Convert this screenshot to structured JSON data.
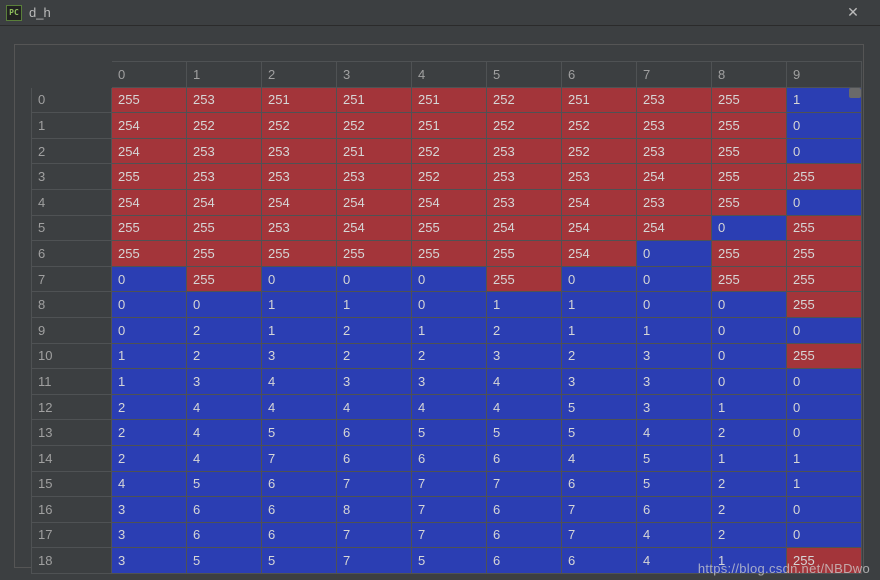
{
  "window": {
    "title": "d_h",
    "icon_text": "PC",
    "close_glyph": "✕"
  },
  "threshold": 128,
  "columns": [
    "0",
    "1",
    "2",
    "3",
    "4",
    "5",
    "6",
    "7",
    "8",
    "9"
  ],
  "rows": [
    "0",
    "1",
    "2",
    "3",
    "4",
    "5",
    "6",
    "7",
    "8",
    "9",
    "10",
    "11",
    "12",
    "13",
    "14",
    "15",
    "16",
    "17",
    "18"
  ],
  "cells": [
    [
      255,
      253,
      251,
      251,
      251,
      252,
      251,
      253,
      255,
      1
    ],
    [
      254,
      252,
      252,
      252,
      251,
      252,
      252,
      253,
      255,
      0
    ],
    [
      254,
      253,
      253,
      251,
      252,
      253,
      252,
      253,
      255,
      0
    ],
    [
      255,
      253,
      253,
      253,
      252,
      253,
      253,
      254,
      255,
      255
    ],
    [
      254,
      254,
      254,
      254,
      254,
      253,
      254,
      253,
      255,
      0
    ],
    [
      255,
      255,
      253,
      254,
      255,
      254,
      254,
      254,
      0,
      255
    ],
    [
      255,
      255,
      255,
      255,
      255,
      255,
      254,
      0,
      255,
      255
    ],
    [
      0,
      255,
      0,
      0,
      0,
      255,
      0,
      0,
      255,
      255
    ],
    [
      0,
      0,
      1,
      1,
      0,
      1,
      1,
      0,
      0,
      255
    ],
    [
      0,
      2,
      1,
      2,
      1,
      2,
      1,
      1,
      0,
      0
    ],
    [
      1,
      2,
      3,
      2,
      2,
      3,
      2,
      3,
      0,
      255
    ],
    [
      1,
      3,
      4,
      3,
      3,
      4,
      3,
      3,
      0,
      0
    ],
    [
      2,
      4,
      4,
      4,
      4,
      4,
      5,
      3,
      1,
      0
    ],
    [
      2,
      4,
      5,
      6,
      5,
      5,
      5,
      4,
      2,
      0
    ],
    [
      2,
      4,
      7,
      6,
      6,
      6,
      4,
      5,
      1,
      1
    ],
    [
      4,
      5,
      6,
      7,
      7,
      7,
      6,
      5,
      2,
      1
    ],
    [
      3,
      6,
      6,
      8,
      7,
      6,
      7,
      6,
      2,
      0
    ],
    [
      3,
      6,
      6,
      7,
      7,
      6,
      7,
      4,
      2,
      0
    ],
    [
      3,
      5,
      5,
      7,
      5,
      6,
      6,
      4,
      1,
      255
    ]
  ],
  "watermark": "https://blog.csdn.net/NBDwo"
}
